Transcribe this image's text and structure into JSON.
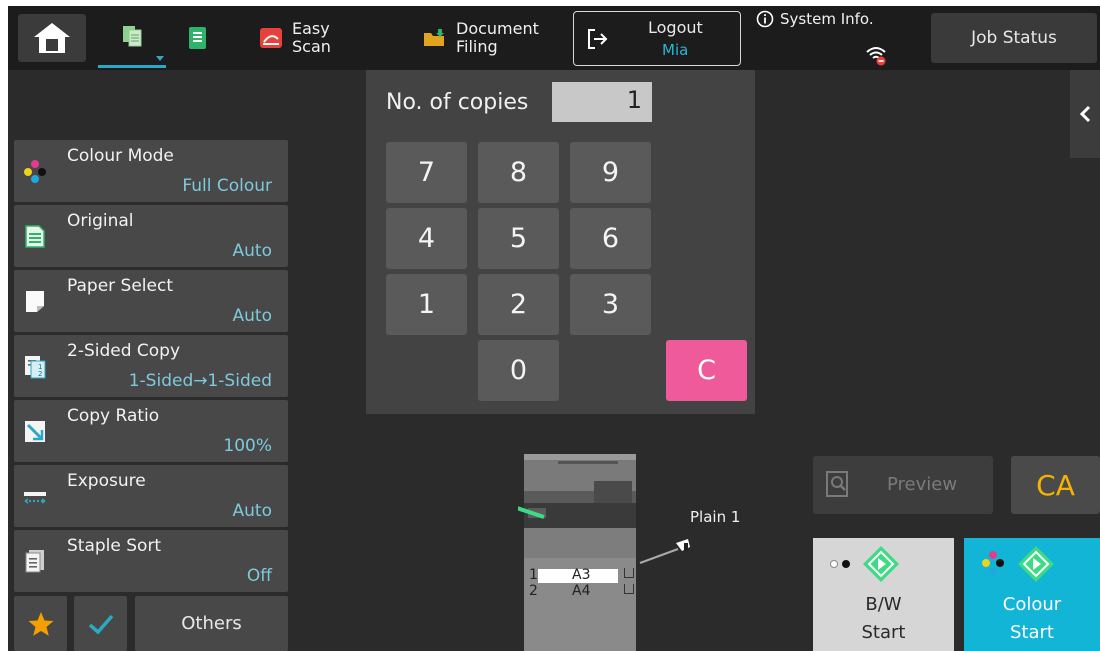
{
  "topbar": {
    "easy_scan_label_1": "Easy",
    "easy_scan_label_2": "Scan",
    "doc_filing_label_1": "Document",
    "doc_filing_label_2": "Filing",
    "logout_label": "Logout",
    "logout_user": "Mia",
    "system_info_label": "System Info.",
    "job_status_label": "Job Status"
  },
  "functions": [
    {
      "name": "Colour Mode",
      "value": "Full Colour",
      "icon": "colour-mode-icon"
    },
    {
      "name": "Original",
      "value": "Auto",
      "icon": "original-icon"
    },
    {
      "name": "Paper Select",
      "value": "Auto",
      "icon": "paper-select-icon"
    },
    {
      "name": "2-Sided Copy",
      "value": "1-Sided→1-Sided",
      "icon": "duplex-icon"
    },
    {
      "name": "Copy Ratio",
      "value": "100%",
      "icon": "copy-ratio-icon"
    },
    {
      "name": "Exposure",
      "value": "Auto",
      "icon": "exposure-icon"
    },
    {
      "name": "Staple Sort",
      "value": "Off",
      "icon": "staple-sort-icon"
    }
  ],
  "bottom_left": {
    "others_label": "Others"
  },
  "keypad": {
    "copies_label": "No. of copies",
    "copies_value": "1",
    "keys": [
      "7",
      "8",
      "9",
      "4",
      "5",
      "6",
      "1",
      "2",
      "3",
      "0"
    ],
    "clear_label": "C"
  },
  "machine": {
    "tray_label": "Plain 1",
    "tray1_num": "1",
    "tray1_size": "A3",
    "tray2_num": "2",
    "tray2_size": "A4"
  },
  "actions": {
    "preview_label": "Preview",
    "ca_label": "CA",
    "bw_start_1": "B/W",
    "bw_start_2": "Start",
    "colour_start_1": "Colour",
    "colour_start_2": "Start"
  },
  "colors": {
    "accent_cyan": "#12b5d6",
    "clear_pink": "#ef5a9a",
    "ca_yellow": "#f5b400",
    "start_green": "#3ddc84"
  }
}
